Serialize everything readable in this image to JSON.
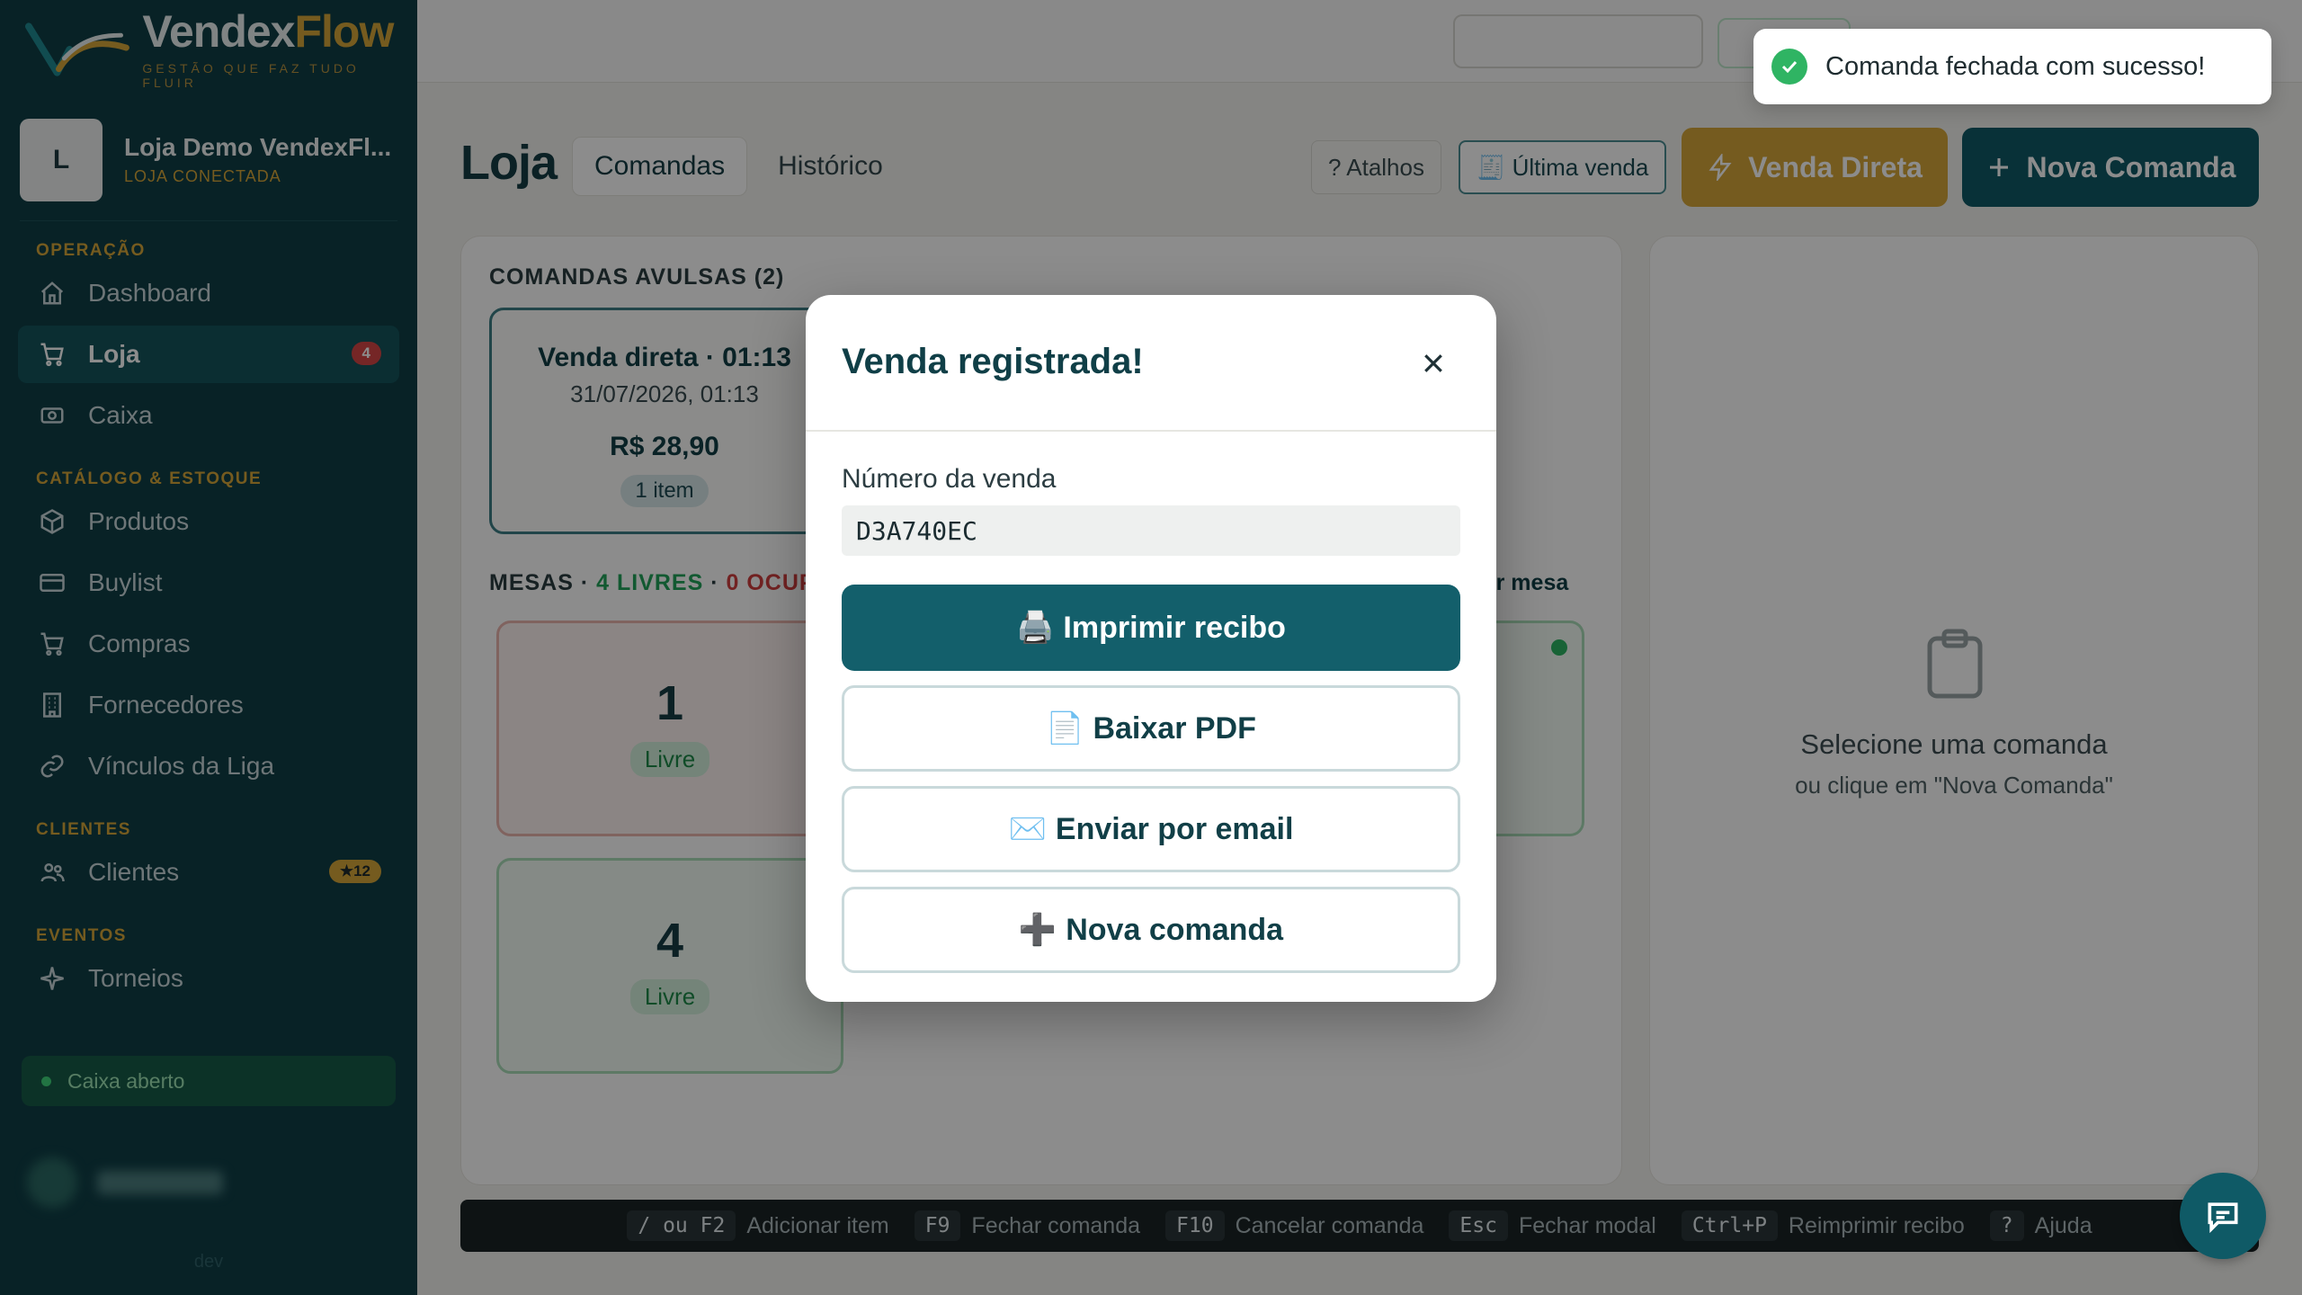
{
  "brand": {
    "name_part1": "Vendex",
    "name_part2": "Flow",
    "tagline": "GESTÃO QUE FAZ TUDO FLUIR"
  },
  "store": {
    "avatar_letter": "L",
    "name": "Loja Demo VendexFl...",
    "status": "LOJA CONECTADA"
  },
  "sidebar": {
    "sections": {
      "operacao": "OPERAÇÃO",
      "catalogo": "CATÁLOGO & ESTOQUE",
      "clientes": "CLIENTES",
      "eventos": "EVENTOS"
    },
    "items": {
      "dashboard": "Dashboard",
      "loja": "Loja",
      "loja_badge": "4",
      "caixa": "Caixa",
      "produtos": "Produtos",
      "buylist": "Buylist",
      "compras": "Compras",
      "fornecedores": "Fornecedores",
      "vinculos": "Vínculos da Liga",
      "clientes": "Clientes",
      "clientes_badge": "★12",
      "torneios": "Torneios"
    },
    "cash_status": "Caixa aberto",
    "env": "dev"
  },
  "header": {
    "title": "Loja",
    "tabs": [
      "Comandas",
      "Histórico"
    ],
    "atalhos": "? Atalhos",
    "ultima_venda": "🧾 Última venda",
    "venda_direta": "Venda Direta",
    "nova_comanda": "Nova Comanda"
  },
  "comandas": {
    "section_title": "COMANDAS AVULSAS (2)",
    "card": {
      "title": "Venda direta · 01:13",
      "date": "31/07/2026, 01:13",
      "total": "R$ 28,90",
      "items": "1 item"
    }
  },
  "mesas": {
    "title_prefix": "MESAS · ",
    "free": "4 LIVRES",
    "sep": " · ",
    "busy": "0 OCUPA",
    "cadastrar": "rar mesa",
    "list": [
      {
        "number": "1",
        "status": "Livre"
      },
      {
        "number": "4",
        "status": "Livre"
      }
    ]
  },
  "empty_state": {
    "title": "Selecione uma comanda",
    "subtitle": "ou clique em \"Nova Comanda\""
  },
  "shortcuts": [
    {
      "key": "/ ou F2",
      "label": "Adicionar item"
    },
    {
      "key": "F9",
      "label": "Fechar comanda"
    },
    {
      "key": "F10",
      "label": "Cancelar comanda"
    },
    {
      "key": "Esc",
      "label": "Fechar modal"
    },
    {
      "key": "Ctrl+P",
      "label": "Reimprimir recibo"
    },
    {
      "key": "?",
      "label": "Ajuda"
    }
  ],
  "modal": {
    "title": "Venda registrada!",
    "number_label": "Número da venda",
    "number_value": "D3A740EC",
    "buttons": {
      "print_icon": "🖨️",
      "print": "Imprimir recibo",
      "pdf_icon": "📄",
      "pdf": "Baixar PDF",
      "email_icon": "✉️",
      "email": "Enviar por email",
      "new_icon": "➕",
      "new": "Nova comanda"
    }
  },
  "toast": {
    "message": "Comanda fechada com sucesso!"
  },
  "colors": {
    "sidebar_bg": "#0f3e46",
    "accent_gold": "#d6a73a",
    "primary_teal": "#135f6b",
    "success_green": "#2fb463",
    "danger_red": "#d64545"
  }
}
